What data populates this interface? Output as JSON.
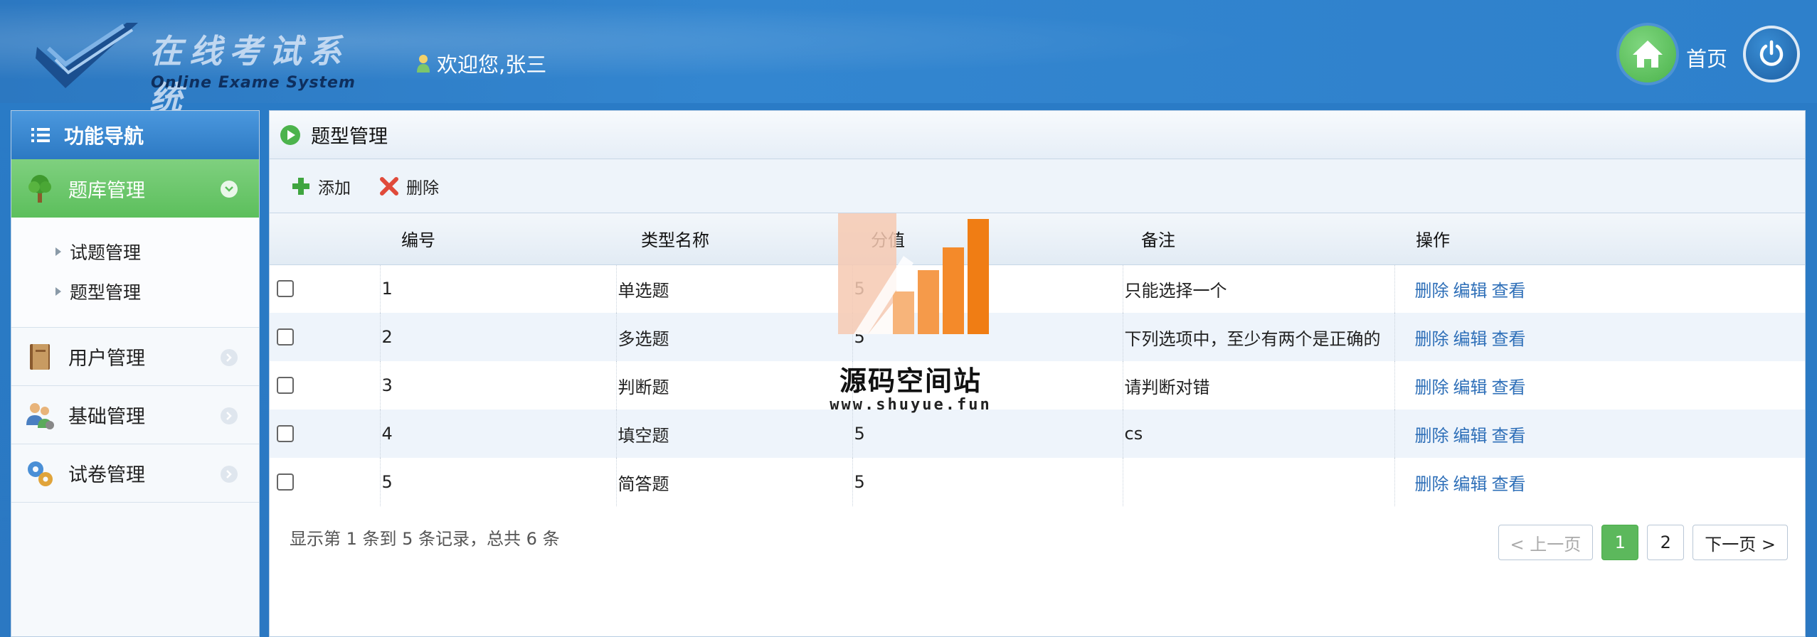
{
  "header": {
    "logo_cn": "在线考试系统",
    "logo_en": "Online Exame System",
    "welcome": "欢迎您,张三",
    "home_label": "首页"
  },
  "sidebar": {
    "title": "功能导航",
    "groups": [
      {
        "label": "题库管理",
        "icon": "tree-icon",
        "expanded": true
      },
      {
        "label": "用户管理",
        "icon": "book-icon",
        "expanded": false
      },
      {
        "label": "基础管理",
        "icon": "users-icon",
        "expanded": false
      },
      {
        "label": "试卷管理",
        "icon": "gears-icon",
        "expanded": false
      }
    ],
    "sub_items": [
      "试题管理",
      "题型管理"
    ]
  },
  "panel": {
    "title": "题型管理",
    "toolbar": {
      "add_label": "添加",
      "delete_label": "删除"
    }
  },
  "table": {
    "columns": [
      "编号",
      "类型名称",
      "分值",
      "备注",
      "操作"
    ],
    "rows": [
      {
        "id": "1",
        "name": "单选题",
        "score": "5",
        "remark": "只能选择一个"
      },
      {
        "id": "2",
        "name": "多选题",
        "score": "5",
        "remark": "下列选项中，至少有两个是正确的"
      },
      {
        "id": "3",
        "name": "判断题",
        "score": "5",
        "remark": "请判断对错"
      },
      {
        "id": "4",
        "name": "填空题",
        "score": "5",
        "remark": "cs"
      },
      {
        "id": "5",
        "name": "简答题",
        "score": "5",
        "remark": ""
      }
    ],
    "ops": {
      "delete": "删除",
      "edit": "编辑",
      "view": "查看"
    }
  },
  "footer": {
    "records_info": "显示第 1 条到 5 条记录，总共 6 条",
    "pager": {
      "prev": "< 上一页",
      "page1": "1",
      "page2": "2",
      "next": "下一页 >"
    }
  },
  "watermark": {
    "title": "源码空间站",
    "url": "www.shuyue.fun"
  },
  "colors": {
    "header_blue": "#2e80cb",
    "active_green": "#5cbf5c",
    "link_blue": "#2e6fb8"
  }
}
